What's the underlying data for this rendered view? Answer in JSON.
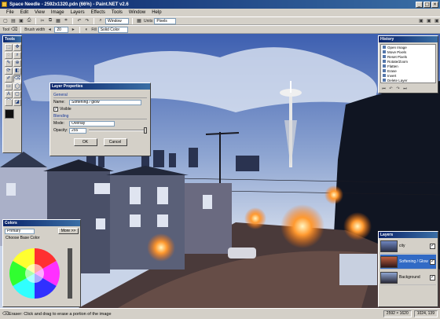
{
  "window": {
    "title": "Space Needle - 2592x1320.pdn (66%) - Paint.NET v2.6",
    "minimize": "_",
    "maximize": "□",
    "close": "×"
  },
  "menu": [
    "File",
    "Edit",
    "View",
    "Image",
    "Layers",
    "Effects",
    "Tools",
    "Window",
    "Help"
  ],
  "toolbar": {
    "zoom_value": "Window",
    "units_label": "Units",
    "units_value": "Pixels",
    "tool_label": "Tool",
    "brush_label": "Brush width",
    "brush_value": "20",
    "fill_label": "Fill",
    "fill_value": "Solid Color"
  },
  "tools_palette": {
    "title": "Tools"
  },
  "tools": [
    "⬚",
    "✥",
    "◌",
    "⌕",
    "✎",
    "⊕",
    "⟳",
    "◧",
    "✐",
    "⌫",
    "▭",
    "◯",
    "A",
    "▢",
    "⌒",
    "◪"
  ],
  "colors_palette": {
    "title": "Colors",
    "mode_value": "Primary",
    "more_button": "More >>",
    "subtitle": "Choose Base Color"
  },
  "history_palette": {
    "title": "History",
    "items": [
      "Open Image",
      "Move Pixels",
      "Reset Pixels",
      "Rotate/Zoom",
      "Flatten",
      "Erase",
      "Invert",
      "Delete Layer",
      "Duplicate Layer",
      "Layer Properties"
    ],
    "selected_index": 9
  },
  "layers_palette": {
    "title": "Layers",
    "layers": [
      {
        "name": "city",
        "visible": true,
        "selected": false
      },
      {
        "name": "Softening / Glow",
        "visible": true,
        "selected": true
      },
      {
        "name": "Background",
        "visible": true,
        "selected": false
      }
    ]
  },
  "dialog": {
    "title": "Layer Properties",
    "general_label": "General",
    "name_label": "Name:",
    "name_value": "Softening / glow",
    "visible_label": "Visible",
    "blending_label": "Blending",
    "mode_label": "Mode:",
    "mode_value": "Overlay",
    "opacity_label": "Opacity:",
    "opacity_value": "255",
    "opacity_fraction": 1.0,
    "ok_label": "OK",
    "cancel_label": "Cancel"
  },
  "status": {
    "text": "Eraser: Click and drag to erase a portion of the image",
    "size": "2592 × 1620",
    "cursor": "1024, 139"
  },
  "colors": {
    "accent": "#0a246a",
    "chrome": "#d4d0c8",
    "selection": "#316ac5"
  }
}
